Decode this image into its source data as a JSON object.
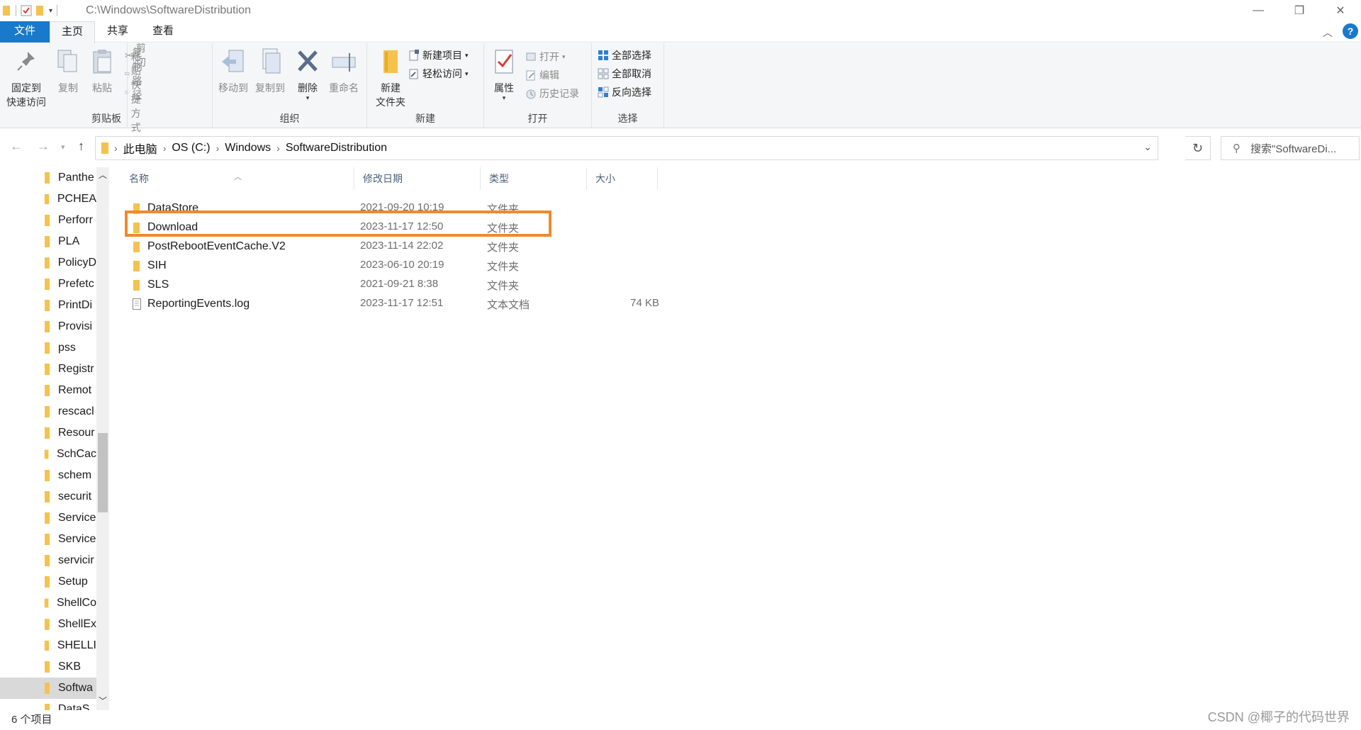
{
  "window": {
    "title_path": "C:\\Windows\\SoftwareDistribution",
    "controls": {
      "minimize": "—",
      "maximize": "❐",
      "close": "✕"
    }
  },
  "ribbon_tabs": [
    {
      "label": "文件"
    },
    {
      "label": "主页"
    },
    {
      "label": "共享"
    },
    {
      "label": "查看"
    }
  ],
  "ribbon": {
    "clipboard": {
      "label": "剪贴板",
      "pin": "固定到",
      "pin2": "快速访问",
      "copy": "复制",
      "paste": "粘贴",
      "cut": "剪切",
      "copy_path": "复制路径",
      "paste_shortcut": "粘贴快捷方式"
    },
    "organize": {
      "label": "组织",
      "move_to": "移动到",
      "copy_to": "复制到",
      "delete": "删除",
      "rename": "重命名"
    },
    "new": {
      "label": "新建",
      "new_folder_1": "新建",
      "new_folder_2": "文件夹",
      "new_item": "新建项目",
      "easy_access": "轻松访问"
    },
    "open": {
      "label": "打开",
      "properties": "属性",
      "open": "打开",
      "edit": "编辑",
      "history": "历史记录"
    },
    "select": {
      "label": "选择",
      "select_all": "全部选择",
      "select_none": "全部取消",
      "invert": "反向选择"
    }
  },
  "address": {
    "crumbs": [
      "此电脑",
      "OS (C:)",
      "Windows",
      "SoftwareDistribution"
    ]
  },
  "search": {
    "placeholder": "搜索\"SoftwareDi..."
  },
  "nav_pane": {
    "items": [
      "Panthe",
      "PCHEA",
      "Perforr",
      "PLA",
      "PolicyD",
      "Prefetc",
      "PrintDi",
      "Provisi",
      "pss",
      "Registr",
      "Remot",
      "rescacl",
      "Resour",
      "SchCac",
      "schem",
      "securit",
      "Service",
      "Service",
      "servicir",
      "Setup",
      "ShellCo",
      "ShellEx",
      "SHELLI",
      "SKB",
      "Softwa",
      "DataS"
    ],
    "selected_index": 24
  },
  "columns": {
    "name": "名称",
    "date": "修改日期",
    "type": "类型",
    "size": "大小"
  },
  "files": [
    {
      "name": "DataStore",
      "date": "2021-09-20 10:19",
      "type": "文件夹",
      "size": "",
      "kind": "folder"
    },
    {
      "name": "Download",
      "date": "2023-11-17 12:50",
      "type": "文件夹",
      "size": "",
      "kind": "folder"
    },
    {
      "name": "PostRebootEventCache.V2",
      "date": "2023-11-14 22:02",
      "type": "文件夹",
      "size": "",
      "kind": "folder"
    },
    {
      "name": "SIH",
      "date": "2023-06-10 20:19",
      "type": "文件夹",
      "size": "",
      "kind": "folder"
    },
    {
      "name": "SLS",
      "date": "2021-09-21 8:38",
      "type": "文件夹",
      "size": "",
      "kind": "folder"
    },
    {
      "name": "ReportingEvents.log",
      "date": "2023-11-17 12:51",
      "type": "文本文档",
      "size": "74 KB",
      "kind": "file"
    }
  ],
  "status": {
    "count": "6 个项目"
  },
  "watermark": "CSDN @椰子的代码世界",
  "colors": {
    "accent": "#1979ca",
    "highlight": "#f08a2c",
    "folder": "#f4c24d"
  }
}
